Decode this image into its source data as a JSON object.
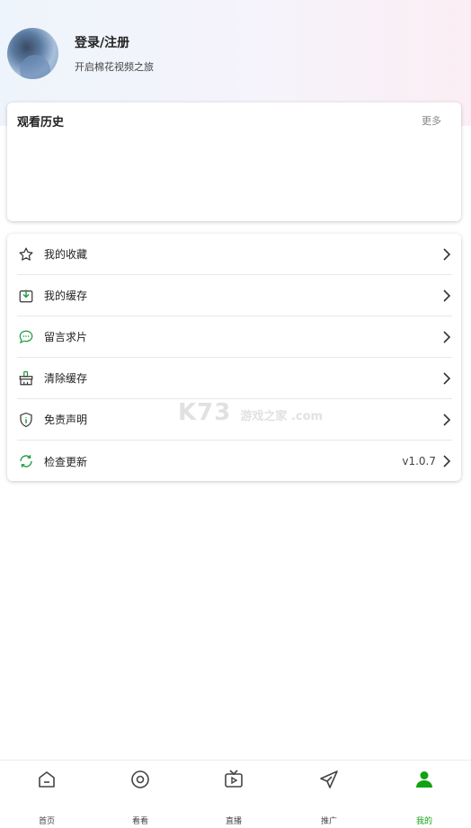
{
  "profile": {
    "title": "登录/注册",
    "subtitle": "开启棉花视频之旅"
  },
  "history": {
    "title": "观看历史",
    "more": "更多"
  },
  "menu": {
    "items": [
      {
        "label": "我的收藏",
        "icon": "star-icon"
      },
      {
        "label": "我的缓存",
        "icon": "download-icon"
      },
      {
        "label": "留言求片",
        "icon": "message-icon"
      },
      {
        "label": "清除缓存",
        "icon": "broom-icon"
      },
      {
        "label": "免责声明",
        "icon": "shield-icon"
      },
      {
        "label": "检查更新",
        "icon": "refresh-icon",
        "value": "v1.0.7"
      }
    ]
  },
  "watermark": {
    "text": "K73",
    "sub": "游戏之家 .com"
  },
  "tabs": [
    {
      "label": "首页",
      "icon": "home-icon"
    },
    {
      "label": "看看",
      "icon": "circle-icon"
    },
    {
      "label": "直播",
      "icon": "tv-icon"
    },
    {
      "label": "推广",
      "icon": "paper-plane-icon"
    },
    {
      "label": "我的",
      "icon": "user-icon"
    }
  ],
  "colors": {
    "accent": "#12a112",
    "icon_green": "#1a9a3a"
  }
}
